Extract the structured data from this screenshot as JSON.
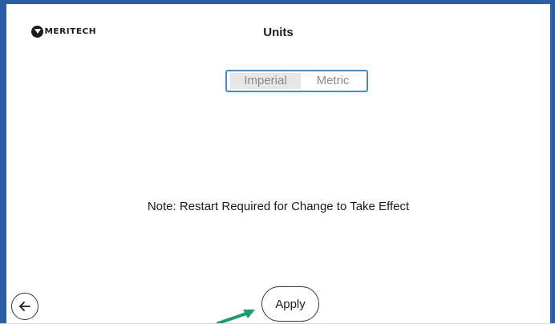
{
  "header": {
    "logo_text": "MERITECH",
    "title": "Units"
  },
  "unit_toggle": {
    "options": [
      "Imperial",
      "Metric"
    ],
    "selected": "Imperial"
  },
  "note": "Note: Restart Required for Change to Take Effect",
  "footer": {
    "apply_label": "Apply",
    "back_icon": "back-arrow-icon"
  },
  "colors": {
    "frame_border": "#2a5fa8",
    "toggle_border": "#4a88c9",
    "selected_bg": "#e6e6e6",
    "pointer_arrow": "#1e9a6a"
  }
}
